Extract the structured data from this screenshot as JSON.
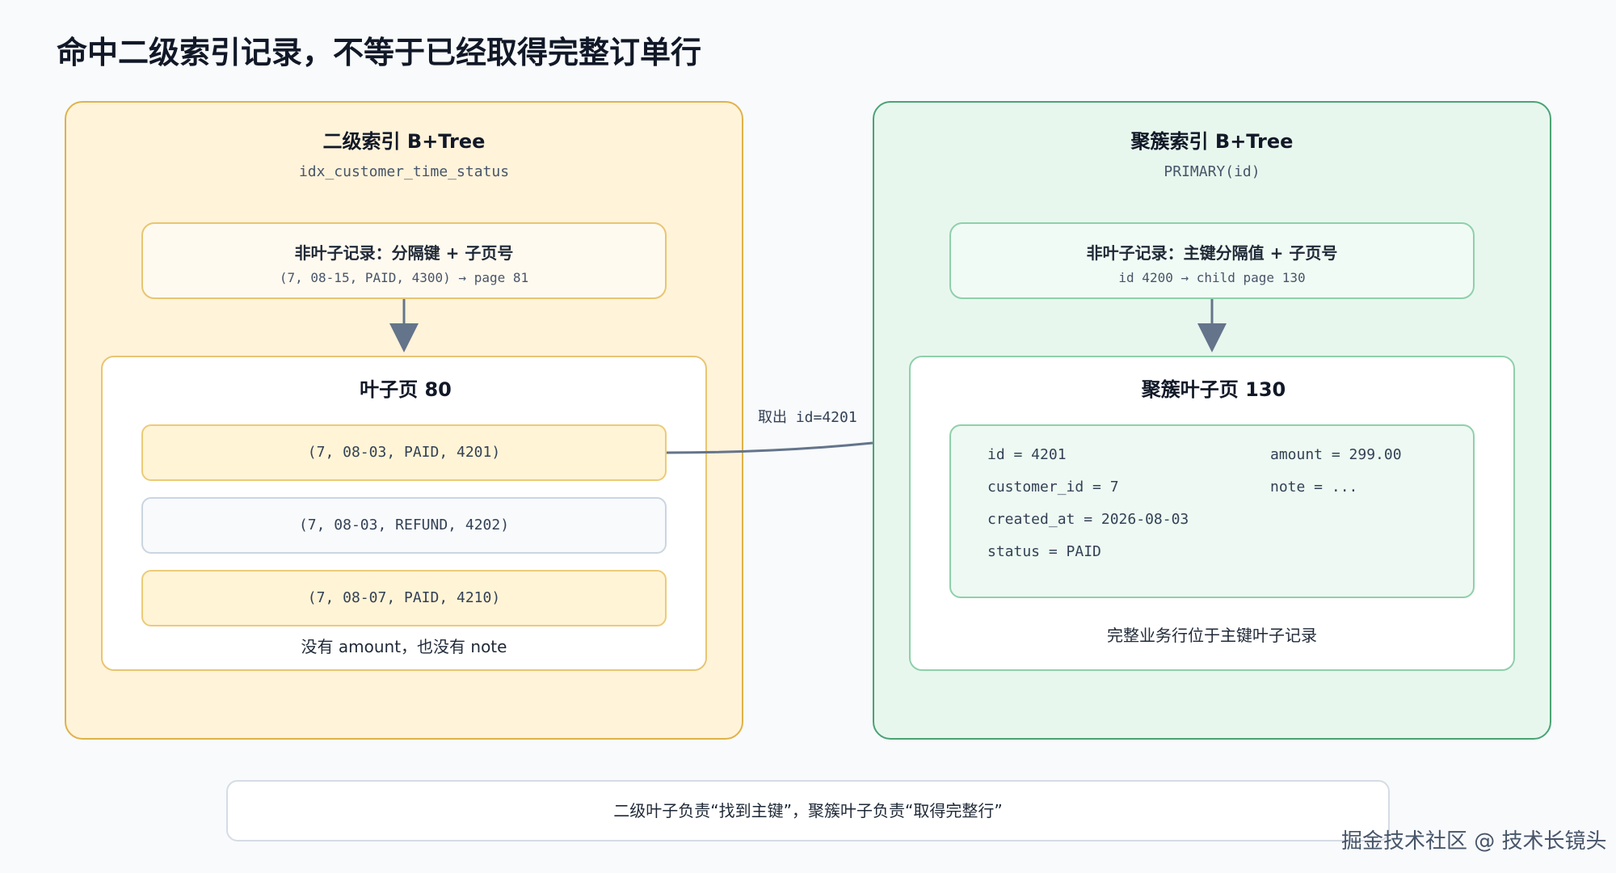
{
  "title": "命中二级索引记录，不等于已经取得完整订单行",
  "left": {
    "title": "二级索引 B+Tree",
    "subtitle": "idx_customer_time_status",
    "nonleaf": {
      "title": "非叶子记录：分隔键 + 子页号",
      "sub": "(7, 08-15, PAID, 4300) → page 81"
    },
    "leaf": {
      "title": "叶子页 80",
      "records": [
        "(7, 08-03, PAID, 4201)",
        "(7, 08-03, REFUND, 4202)",
        "(7, 08-07, PAID, 4210)"
      ],
      "note": "没有 amount，也没有 note"
    }
  },
  "right": {
    "title": "聚簇索引 B+Tree",
    "subtitle": "PRIMARY(id)",
    "nonleaf": {
      "title": "非叶子记录：主键分隔值 + 子页号",
      "sub": "id 4200 → child page 130"
    },
    "leaf": {
      "title": "聚簇叶子页 130",
      "fields_left": [
        "id = 4201",
        "customer_id = 7",
        "created_at = 2026-08-03",
        "status = PAID"
      ],
      "fields_right": [
        "amount = 299.00",
        "note = ..."
      ],
      "note": "完整业务行位于主键叶子记录"
    }
  },
  "connector_label": "取出 id=4201",
  "footer": "二级叶子负责“找到主键”，聚簇叶子负责“取得完整行”",
  "watermark": "掘金技术社区 @ 技术长镜头",
  "colors": {
    "left_panel": "#fff3da",
    "left_border": "#e0b24a",
    "right_panel": "#e8f7ee",
    "right_border": "#4aa373",
    "arrow": "#64748b"
  }
}
